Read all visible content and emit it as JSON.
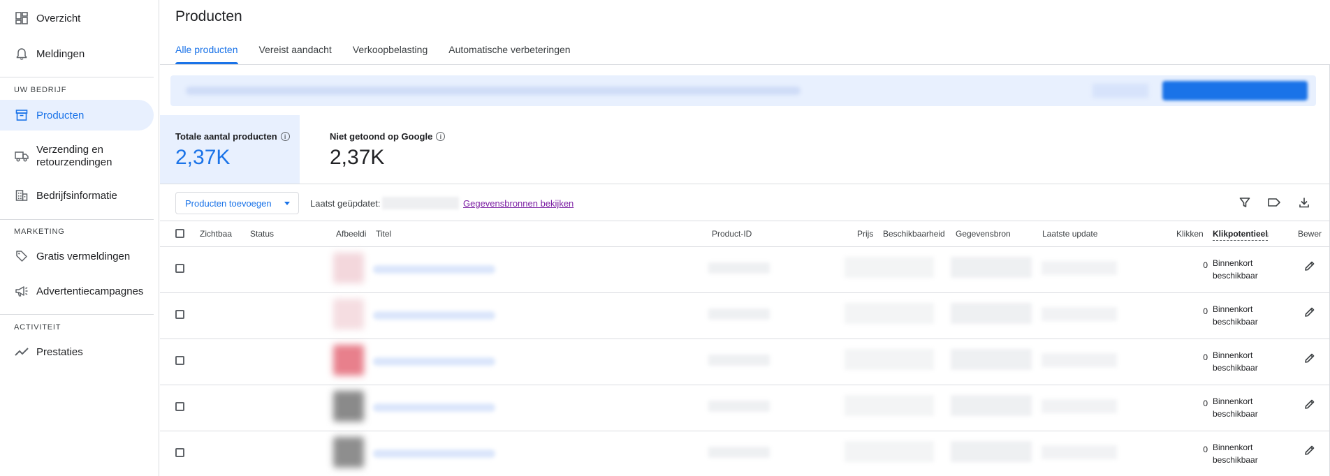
{
  "sidebar": {
    "items": [
      {
        "label": "Overzicht",
        "icon": "dashboard-icon"
      },
      {
        "label": "Meldingen",
        "icon": "bell-icon"
      },
      {
        "label": "Producten",
        "icon": "archive-icon",
        "active": true
      },
      {
        "label": "Verzending en retourzendingen",
        "icon": "truck-icon"
      },
      {
        "label": "Bedrijfsinformatie",
        "icon": "building-icon"
      },
      {
        "label": "Gratis vermeldingen",
        "icon": "tag-icon"
      },
      {
        "label": "Advertentiecampagnes",
        "icon": "megaphone-icon"
      },
      {
        "label": "Prestaties",
        "icon": "trending-icon"
      }
    ],
    "sections": {
      "business": "UW BEDRIJF",
      "marketing": "MARKETING",
      "activity": "ACTIVITEIT"
    }
  },
  "page": {
    "title": "Producten",
    "tabs": [
      "Alle producten",
      "Vereist aandacht",
      "Verkoopbelasting",
      "Automatische verbeteringen"
    ]
  },
  "summary": {
    "total_label": "Totale aantal producten",
    "total_value": "2,37K",
    "hidden_label": "Niet getoond op Google",
    "hidden_value": "2,37K"
  },
  "toolbar": {
    "add_button": "Producten toevoegen",
    "last_updated_label": "Laatst geüpdatet:",
    "sources_link": "Gegevensbronnen bekijken",
    "icons": [
      "filter-icon",
      "label-icon",
      "download-icon"
    ]
  },
  "table": {
    "headers": {
      "visibility": "Zichtbaa",
      "status": "Status",
      "image": "Afbeeldi",
      "title": "Titel",
      "product_id": "Product-ID",
      "price": "Prijs",
      "availability": "Beschikbaarheid",
      "data_source": "Gegevensbron",
      "last_update": "Laatste update",
      "clicks": "Klikken",
      "click_potential": "Klikpotentieel",
      "edit": "Bewer"
    },
    "rows": [
      {
        "clicks": "0",
        "potential_line1": "Binnenkort",
        "potential_line2": "beschikbaar",
        "thumb_color": "#f3d7dc"
      },
      {
        "clicks": "0",
        "potential_line1": "Binnenkort",
        "potential_line2": "beschikbaar",
        "thumb_color": "#f5dde1"
      },
      {
        "clicks": "0",
        "potential_line1": "Binnenkort",
        "potential_line2": "beschikbaar",
        "thumb_color": "#e8808c"
      },
      {
        "clicks": "0",
        "potential_line1": "Binnenkort",
        "potential_line2": "beschikbaar",
        "thumb_color": "#8a8a8a"
      },
      {
        "clicks": "0",
        "potential_line1": "Binnenkort",
        "potential_line2": "beschikbaar",
        "thumb_color": "#8e8e8e"
      }
    ]
  },
  "colors": {
    "accent": "#1a73e8",
    "active_bg": "#e8f0fe",
    "link_visited": "#7b1fa2"
  }
}
